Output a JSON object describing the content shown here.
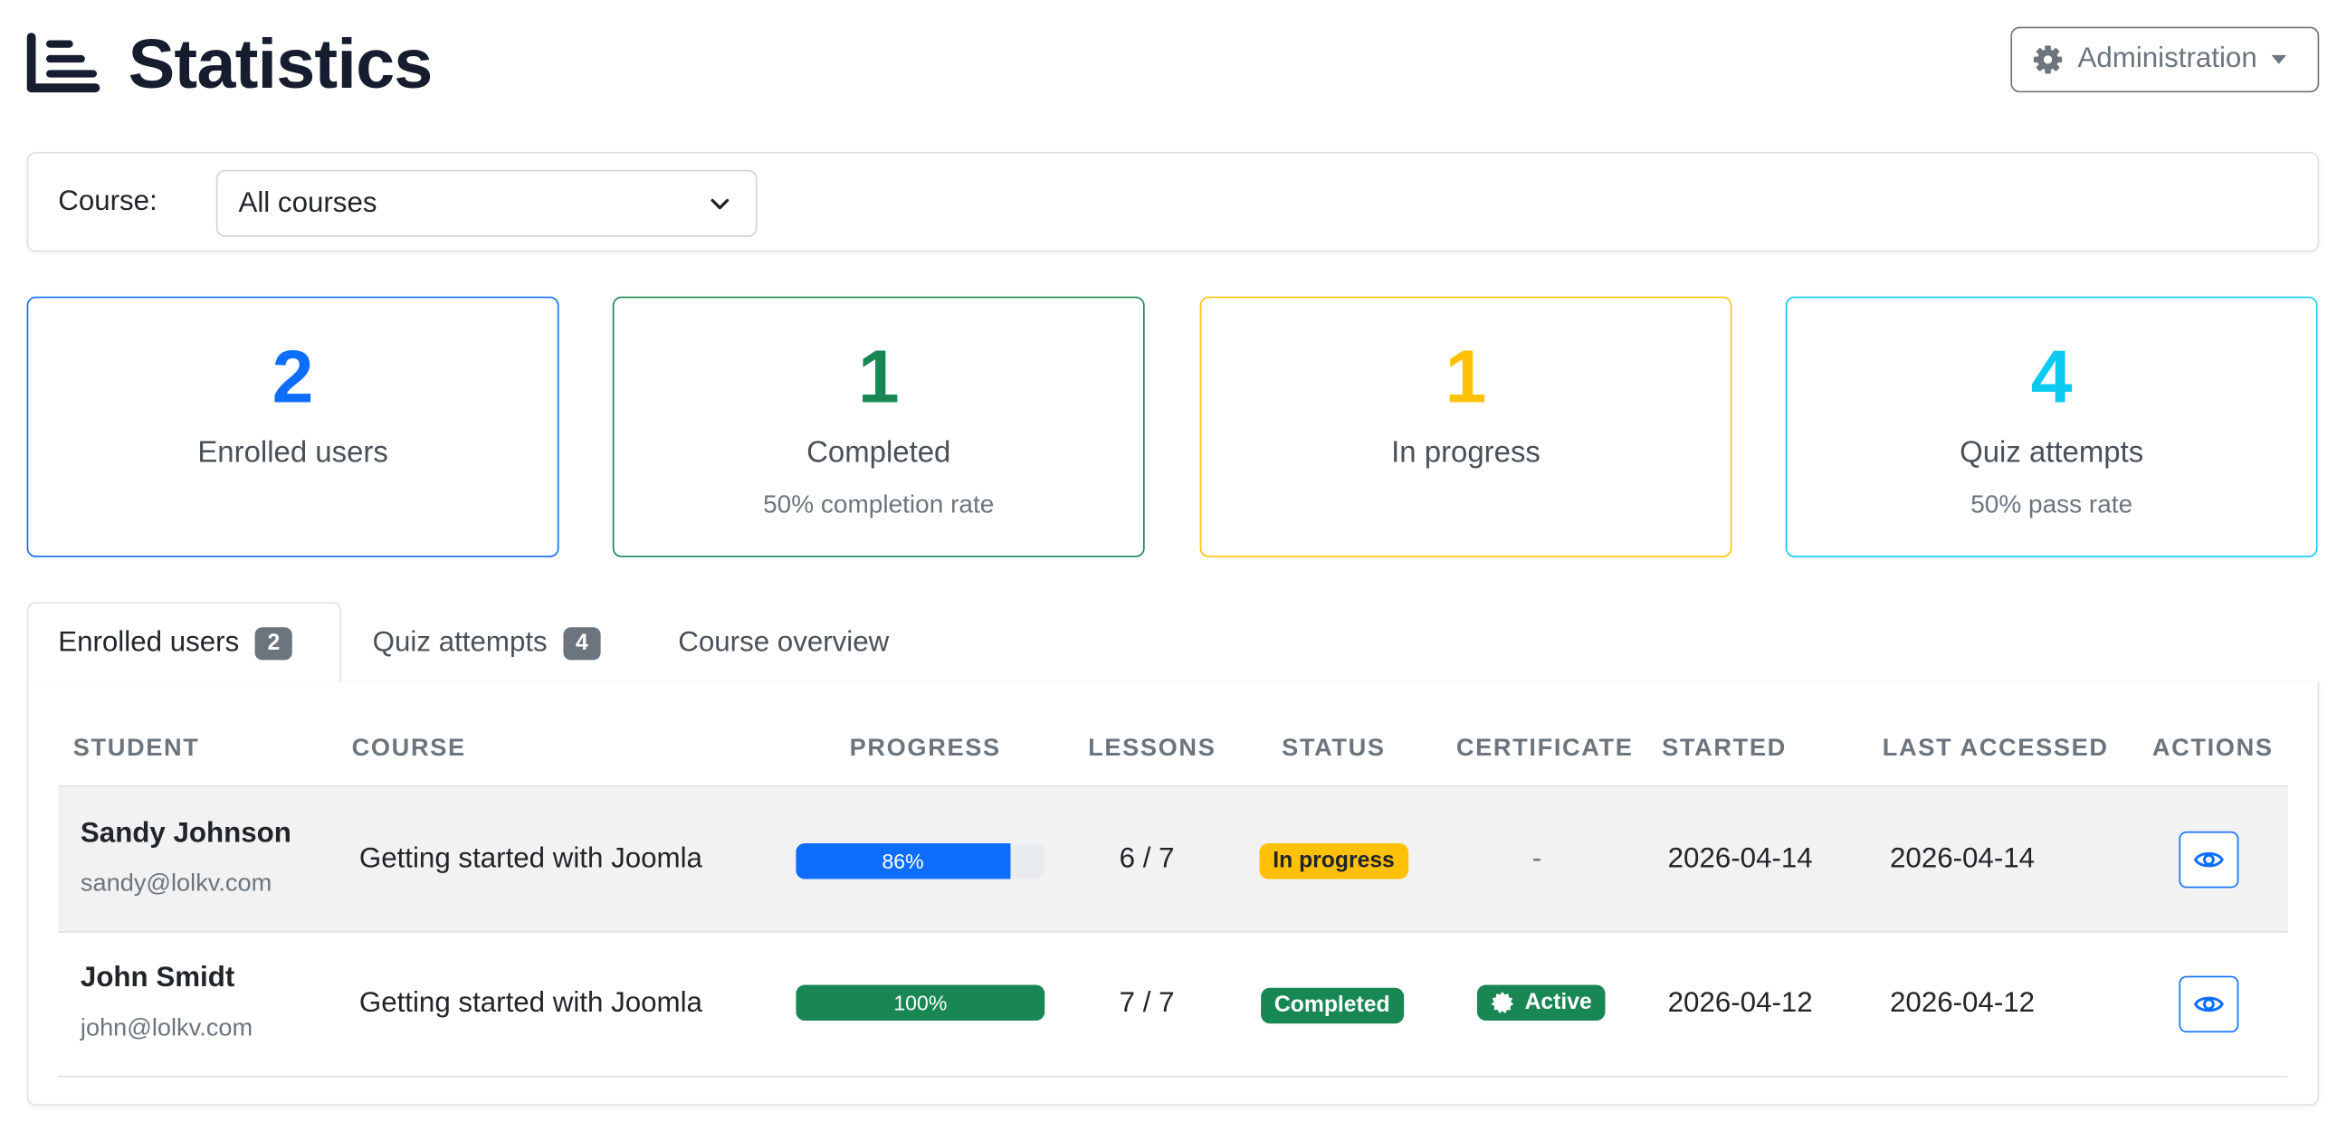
{
  "header": {
    "title": "Statistics",
    "admin_button_label": "Administration"
  },
  "filter": {
    "label": "Course:",
    "selected": "All courses"
  },
  "stats": [
    {
      "value": "2",
      "label": "Enrolled users",
      "sub": "",
      "color": "#0d6efd"
    },
    {
      "value": "1",
      "label": "Completed",
      "sub": "50% completion rate",
      "color": "#198754"
    },
    {
      "value": "1",
      "label": "In progress",
      "sub": "",
      "color": "#ffc107"
    },
    {
      "value": "4",
      "label": "Quiz attempts",
      "sub": "50% pass rate",
      "color": "#0dcaf0"
    }
  ],
  "tabs": [
    {
      "label": "Enrolled users",
      "badge": "2",
      "active": true
    },
    {
      "label": "Quiz attempts",
      "badge": "4",
      "active": false
    },
    {
      "label": "Course overview",
      "badge": "",
      "active": false
    }
  ],
  "table": {
    "headers": {
      "student": "STUDENT",
      "course": "COURSE",
      "progress": "PROGRESS",
      "lessons": "LESSONS",
      "status": "STATUS",
      "certificate": "CERTIFICATE",
      "started": "STARTED",
      "last_accessed": "LAST ACCESSED",
      "actions": "ACTIONS"
    },
    "rows": [
      {
        "name": "Sandy Johnson",
        "email": "sandy@lolkv.com",
        "course": "Getting started with Joomla",
        "progress_label": "86%",
        "progress_value": 0.86,
        "lessons": "6 / 7",
        "status": "In progress",
        "certificate": "-",
        "started": "2026-04-14",
        "last_accessed": "2026-04-14"
      },
      {
        "name": "John Smidt",
        "email": "john@lolkv.com",
        "course": "Getting started with Joomla",
        "progress_label": "100%",
        "progress_value": 1.0,
        "lessons": "7 / 7",
        "status": "Completed",
        "certificate": "Active",
        "started": "2026-04-12",
        "last_accessed": "2026-04-12"
      }
    ]
  },
  "colors": {
    "primary": "#0d6efd",
    "success": "#198754",
    "warning": "#ffc107",
    "info": "#0dcaf0",
    "secondary": "#6c757d"
  },
  "icons": {
    "title": "list-icon",
    "admin": "gear-icon",
    "select": "chevron-down-icon",
    "view": "eye-icon",
    "certificate": "badge-check-icon"
  }
}
